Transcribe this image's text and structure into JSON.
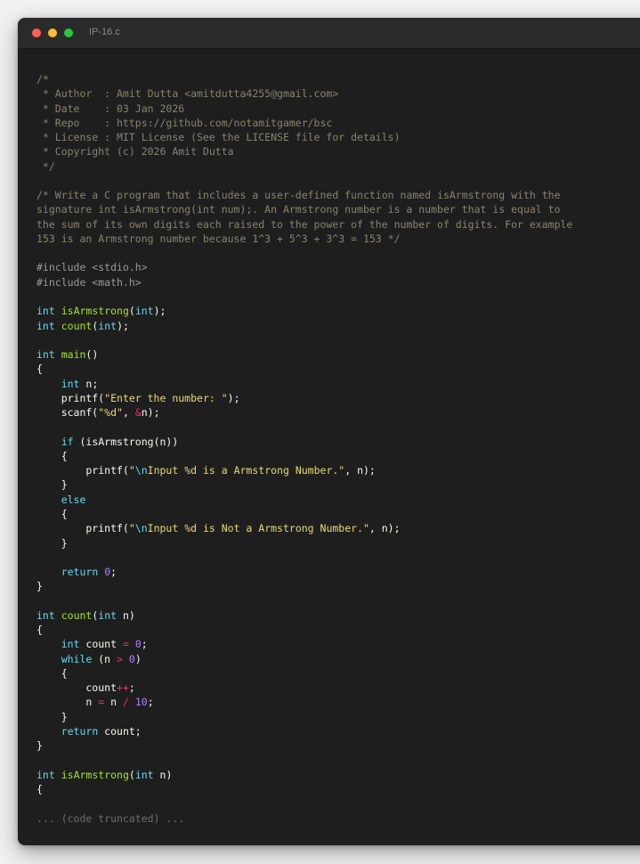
{
  "window": {
    "title": "IP-16.c"
  },
  "code": {
    "lines": [
      [
        {
          "t": "/*",
          "c": "com"
        }
      ],
      [
        {
          "t": " * Author  : Amit Dutta <amitdutta4255@gmail.com>",
          "c": "com"
        }
      ],
      [
        {
          "t": " * Date    : 03 Jan 2026",
          "c": "com"
        }
      ],
      [
        {
          "t": " * Repo    : https://github.com/notamitgamer/bsc",
          "c": "com"
        }
      ],
      [
        {
          "t": " * License : MIT License (See the LICENSE file for details)",
          "c": "com"
        }
      ],
      [
        {
          "t": " * Copyright (c) 2026 Amit Dutta",
          "c": "com"
        }
      ],
      [
        {
          "t": " */",
          "c": "com"
        }
      ],
      [],
      [
        {
          "t": "/* Write a C program that includes a user-defined function named isArmstrong with the",
          "c": "com"
        }
      ],
      [
        {
          "t": "signature int isArmstrong(int num);. An Armstrong number is a number that is equal to",
          "c": "com"
        }
      ],
      [
        {
          "t": "the sum of its own digits each raised to the power of the number of digits. For example",
          "c": "com"
        }
      ],
      [
        {
          "t": "153 is an Armstrong number because 1^3 + 5^3 + 3^3 = 153 */",
          "c": "com"
        }
      ],
      [],
      [
        {
          "t": "#include <stdio.h>",
          "c": "pre"
        }
      ],
      [
        {
          "t": "#include <math.h>",
          "c": "pre"
        }
      ],
      [],
      [
        {
          "t": "int",
          "c": "type"
        },
        {
          "t": " "
        },
        {
          "t": "isArmstrong",
          "c": "fn"
        },
        {
          "t": "("
        },
        {
          "t": "int",
          "c": "type"
        },
        {
          "t": ");"
        }
      ],
      [
        {
          "t": "int",
          "c": "type"
        },
        {
          "t": " "
        },
        {
          "t": "count",
          "c": "fn"
        },
        {
          "t": "("
        },
        {
          "t": "int",
          "c": "type"
        },
        {
          "t": ");"
        }
      ],
      [],
      [
        {
          "t": "int",
          "c": "type"
        },
        {
          "t": " "
        },
        {
          "t": "main",
          "c": "fn"
        },
        {
          "t": "()"
        }
      ],
      [
        {
          "t": "{"
        }
      ],
      [
        {
          "t": "    "
        },
        {
          "t": "int",
          "c": "type"
        },
        {
          "t": " n;"
        }
      ],
      [
        {
          "t": "    printf("
        },
        {
          "t": "\"Enter the number: \"",
          "c": "str"
        },
        {
          "t": ");"
        }
      ],
      [
        {
          "t": "    scanf("
        },
        {
          "t": "\"%d\"",
          "c": "str"
        },
        {
          "t": ", "
        },
        {
          "t": "&",
          "c": "op"
        },
        {
          "t": "n);"
        }
      ],
      [],
      [
        {
          "t": "    "
        },
        {
          "t": "if",
          "c": "kw"
        },
        {
          "t": " (isArmstrong(n))"
        }
      ],
      [
        {
          "t": "    {"
        }
      ],
      [
        {
          "t": "        printf("
        },
        {
          "t": "\"",
          "c": "str"
        },
        {
          "t": "\\n",
          "c": "esc"
        },
        {
          "t": "Input %d is a Armstrong Number.\"",
          "c": "str"
        },
        {
          "t": ", n);"
        }
      ],
      [
        {
          "t": "    }"
        }
      ],
      [
        {
          "t": "    "
        },
        {
          "t": "else",
          "c": "kw"
        }
      ],
      [
        {
          "t": "    {"
        }
      ],
      [
        {
          "t": "        printf("
        },
        {
          "t": "\"",
          "c": "str"
        },
        {
          "t": "\\n",
          "c": "esc"
        },
        {
          "t": "Input %d is Not a Armstrong Number.\"",
          "c": "str"
        },
        {
          "t": ", n);"
        }
      ],
      [
        {
          "t": "    }"
        }
      ],
      [],
      [
        {
          "t": "    "
        },
        {
          "t": "return",
          "c": "kw"
        },
        {
          "t": " "
        },
        {
          "t": "0",
          "c": "num"
        },
        {
          "t": ";"
        }
      ],
      [
        {
          "t": "}"
        }
      ],
      [],
      [
        {
          "t": "int",
          "c": "type"
        },
        {
          "t": " "
        },
        {
          "t": "count",
          "c": "fn"
        },
        {
          "t": "("
        },
        {
          "t": "int",
          "c": "type"
        },
        {
          "t": " n)"
        }
      ],
      [
        {
          "t": "{"
        }
      ],
      [
        {
          "t": "    "
        },
        {
          "t": "int",
          "c": "type"
        },
        {
          "t": " count "
        },
        {
          "t": "=",
          "c": "op"
        },
        {
          "t": " "
        },
        {
          "t": "0",
          "c": "num"
        },
        {
          "t": ";"
        }
      ],
      [
        {
          "t": "    "
        },
        {
          "t": "while",
          "c": "kw"
        },
        {
          "t": " (n "
        },
        {
          "t": ">",
          "c": "op"
        },
        {
          "t": " "
        },
        {
          "t": "0",
          "c": "num"
        },
        {
          "t": ")"
        }
      ],
      [
        {
          "t": "    {"
        }
      ],
      [
        {
          "t": "        count"
        },
        {
          "t": "++",
          "c": "op"
        },
        {
          "t": ";"
        }
      ],
      [
        {
          "t": "        n "
        },
        {
          "t": "=",
          "c": "op"
        },
        {
          "t": " n "
        },
        {
          "t": "/",
          "c": "op"
        },
        {
          "t": " "
        },
        {
          "t": "10",
          "c": "num"
        },
        {
          "t": ";"
        }
      ],
      [
        {
          "t": "    }"
        }
      ],
      [
        {
          "t": "    "
        },
        {
          "t": "return",
          "c": "kw"
        },
        {
          "t": " count;"
        }
      ],
      [
        {
          "t": "}"
        }
      ],
      [],
      [
        {
          "t": "int",
          "c": "type"
        },
        {
          "t": " "
        },
        {
          "t": "isArmstrong",
          "c": "fn"
        },
        {
          "t": "("
        },
        {
          "t": "int",
          "c": "type"
        },
        {
          "t": " n)"
        }
      ],
      [
        {
          "t": "{"
        }
      ],
      [],
      [
        {
          "t": "... (code truncated) ...",
          "c": "trunc"
        }
      ]
    ]
  }
}
